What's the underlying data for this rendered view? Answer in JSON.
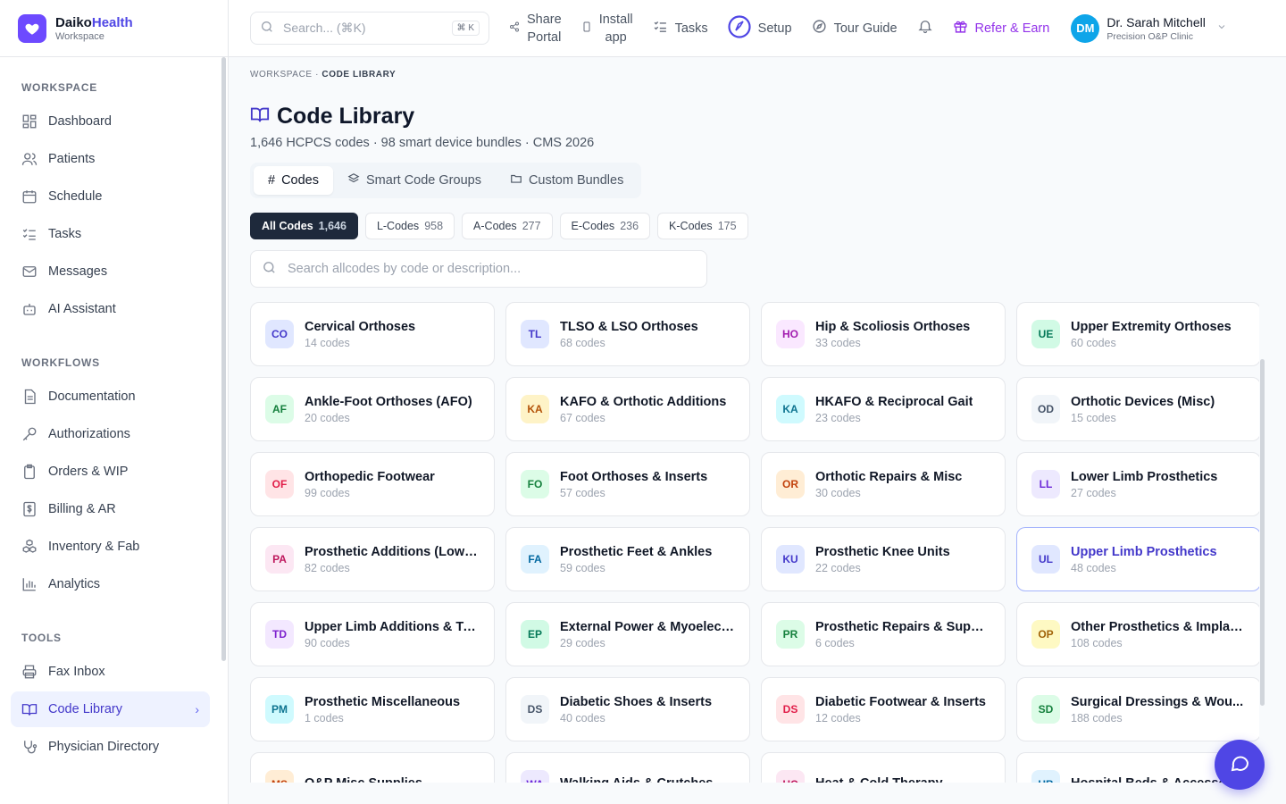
{
  "brand": {
    "name_main": "Daiko",
    "name_accent": "Health",
    "sub": "Workspace"
  },
  "sidebar": {
    "sections": [
      {
        "title": "WORKSPACE",
        "items": [
          {
            "label": "Dashboard",
            "icon": "dashboard-icon"
          },
          {
            "label": "Patients",
            "icon": "users-icon"
          },
          {
            "label": "Schedule",
            "icon": "calendar-icon"
          },
          {
            "label": "Tasks",
            "icon": "list-checks-icon"
          },
          {
            "label": "Messages",
            "icon": "mail-icon"
          },
          {
            "label": "AI Assistant",
            "icon": "bot-icon"
          }
        ]
      },
      {
        "title": "WORKFLOWS",
        "items": [
          {
            "label": "Documentation",
            "icon": "document-icon"
          },
          {
            "label": "Authorizations",
            "icon": "key-icon"
          },
          {
            "label": "Orders & WIP",
            "icon": "clipboard-icon"
          },
          {
            "label": "Billing & AR",
            "icon": "dollar-receipt-icon"
          },
          {
            "label": "Inventory & Fab",
            "icon": "boxes-icon"
          },
          {
            "label": "Analytics",
            "icon": "bar-chart-icon"
          }
        ]
      },
      {
        "title": "TOOLS",
        "items": [
          {
            "label": "Fax Inbox",
            "icon": "printer-icon"
          },
          {
            "label": "Code Library",
            "icon": "book-open-icon",
            "active": true
          },
          {
            "label": "Physician Directory",
            "icon": "stethoscope-icon"
          }
        ]
      }
    ]
  },
  "topbar": {
    "search_placeholder": "Search... (⌘K)",
    "search_kbd": "⌘ K",
    "share_l1": "Share",
    "share_l2": "Portal",
    "install_l1": "Install",
    "install_l2": "app",
    "tasks": "Tasks",
    "setup": "Setup",
    "tour": "Tour Guide",
    "refer": "Refer & Earn",
    "user_initials": "DM",
    "user_name": "Dr. Sarah Mitchell",
    "user_org": "Precision O&P Clinic"
  },
  "page": {
    "breadcrumb_root": "WORKSPACE",
    "breadcrumb_current": "CODE LIBRARY",
    "title": "Code Library",
    "subtitle": "1,646 HCPCS codes · 98 smart device bundles · CMS 2026",
    "tabs": [
      {
        "label": "Codes",
        "icon": "hash-icon",
        "active": true
      },
      {
        "label": "Smart Code Groups",
        "icon": "layers-icon"
      },
      {
        "label": "Custom Bundles",
        "icon": "folder-icon"
      }
    ],
    "chips": [
      {
        "label": "All Codes",
        "count": "1,646",
        "active": true
      },
      {
        "label": "L-Codes",
        "count": "958"
      },
      {
        "label": "A-Codes",
        "count": "277"
      },
      {
        "label": "E-Codes",
        "count": "236"
      },
      {
        "label": "K-Codes",
        "count": "175"
      }
    ],
    "code_search_placeholder": "Search allcodes by code or description..."
  },
  "categories": [
    {
      "abbr": "CO",
      "name": "Cervical Orthoses",
      "count": "14 codes",
      "bg": "#e0e7ff",
      "fg": "#4338ca"
    },
    {
      "abbr": "TL",
      "name": "TLSO & LSO Orthoses",
      "count": "68 codes",
      "bg": "#e0e7ff",
      "fg": "#4338ca"
    },
    {
      "abbr": "HO",
      "name": "Hip & Scoliosis Orthoses",
      "count": "33 codes",
      "bg": "#fae8ff",
      "fg": "#a21caf"
    },
    {
      "abbr": "UE",
      "name": "Upper Extremity Orthoses",
      "count": "60 codes",
      "bg": "#d1fae5",
      "fg": "#047857"
    },
    {
      "abbr": "AF",
      "name": "Ankle-Foot Orthoses (AFO)",
      "count": "20 codes",
      "bg": "#dcfce7",
      "fg": "#15803d"
    },
    {
      "abbr": "KA",
      "name": "KAFO & Orthotic Additions",
      "count": "67 codes",
      "bg": "#fef3c7",
      "fg": "#b45309"
    },
    {
      "abbr": "KA",
      "name": "HKAFO & Reciprocal Gait",
      "count": "23 codes",
      "bg": "#cffafe",
      "fg": "#0e7490"
    },
    {
      "abbr": "OD",
      "name": "Orthotic Devices (Misc)",
      "count": "15 codes",
      "bg": "#f1f5f9",
      "fg": "#475569"
    },
    {
      "abbr": "OF",
      "name": "Orthopedic Footwear",
      "count": "99 codes",
      "bg": "#ffe4e6",
      "fg": "#e11d48"
    },
    {
      "abbr": "FO",
      "name": "Foot Orthoses & Inserts",
      "count": "57 codes",
      "bg": "#dcfce7",
      "fg": "#15803d"
    },
    {
      "abbr": "OR",
      "name": "Orthotic Repairs & Misc",
      "count": "30 codes",
      "bg": "#ffedd5",
      "fg": "#c2410c"
    },
    {
      "abbr": "LL",
      "name": "Lower Limb Prosthetics",
      "count": "27 codes",
      "bg": "#ede9fe",
      "fg": "#6d28d9"
    },
    {
      "abbr": "PA",
      "name": "Prosthetic Additions (Lower)",
      "count": "82 codes",
      "bg": "#fce7f3",
      "fg": "#be185d"
    },
    {
      "abbr": "FA",
      "name": "Prosthetic Feet & Ankles",
      "count": "59 codes",
      "bg": "#e0f2fe",
      "fg": "#0369a1"
    },
    {
      "abbr": "KU",
      "name": "Prosthetic Knee Units",
      "count": "22 codes",
      "bg": "#e0e7ff",
      "fg": "#4338ca"
    },
    {
      "abbr": "UL",
      "name": "Upper Limb Prosthetics",
      "count": "48 codes",
      "bg": "#e0e7ff",
      "fg": "#4338ca",
      "selected": true
    },
    {
      "abbr": "TD",
      "name": "Upper Limb Additions & Te...",
      "count": "90 codes",
      "bg": "#f3e8ff",
      "fg": "#7e22ce"
    },
    {
      "abbr": "EP",
      "name": "External Power & Myoelect...",
      "count": "29 codes",
      "bg": "#d1fae5",
      "fg": "#047857"
    },
    {
      "abbr": "PR",
      "name": "Prosthetic Repairs & Suppl...",
      "count": "6 codes",
      "bg": "#dcfce7",
      "fg": "#15803d"
    },
    {
      "abbr": "OP",
      "name": "Other Prosthetics & Implants",
      "count": "108 codes",
      "bg": "#fef9c3",
      "fg": "#a16207"
    },
    {
      "abbr": "PM",
      "name": "Prosthetic Miscellaneous",
      "count": "1 codes",
      "bg": "#cffafe",
      "fg": "#0e7490"
    },
    {
      "abbr": "DS",
      "name": "Diabetic Shoes & Inserts",
      "count": "40 codes",
      "bg": "#f1f5f9",
      "fg": "#475569"
    },
    {
      "abbr": "DS",
      "name": "Diabetic Footwear & Inserts",
      "count": "12 codes",
      "bg": "#ffe4e6",
      "fg": "#e11d48"
    },
    {
      "abbr": "SD",
      "name": "Surgical Dressings & Wou...",
      "count": "188 codes",
      "bg": "#dcfce7",
      "fg": "#15803d"
    },
    {
      "abbr": "MS",
      "name": "O&P Misc Supplies",
      "count": "",
      "bg": "#ffedd5",
      "fg": "#c2410c"
    },
    {
      "abbr": "WA",
      "name": "Walking Aids & Crutches",
      "count": "",
      "bg": "#ede9fe",
      "fg": "#6d28d9"
    },
    {
      "abbr": "HC",
      "name": "Heat & Cold Therapy",
      "count": "",
      "bg": "#fce7f3",
      "fg": "#be185d"
    },
    {
      "abbr": "HB",
      "name": "Hospital Beds & Accesso...",
      "count": "",
      "bg": "#e0f2fe",
      "fg": "#0369a1"
    }
  ]
}
